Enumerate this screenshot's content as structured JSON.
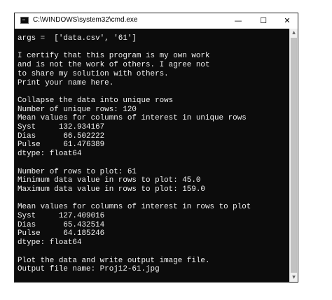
{
  "window": {
    "title": "C:\\WINDOWS\\system32\\cmd.exe",
    "app_icon": "console-icon",
    "controls": {
      "minimize": "—",
      "maximize": "☐",
      "close": "✕"
    }
  },
  "console": {
    "lines": [
      "args =  ['data.csv', '61']",
      "",
      "I certify that this program is my own work",
      "and is not the work of others. I agree not",
      "to share my solution with others.",
      "Print your name here.",
      "",
      "Collapse the data into unique rows",
      "Number of unique rows: 120",
      "Mean values for columns of interest in unique rows",
      "Syst     132.934167",
      "Dias      66.502222",
      "Pulse     61.476389",
      "dtype: float64",
      "",
      "Number of rows to plot: 61",
      "Minimum data value in rows to plot: 45.0",
      "Maximum data value in rows to plot: 159.0",
      "",
      "Mean values for columns of interest in rows to plot",
      "Syst     127.409016",
      "Dias      65.432514",
      "Pulse     64.185246",
      "dtype: float64",
      "",
      "Plot the data and write output image file.",
      "Output file name: Proj12-61.jpg"
    ]
  },
  "scrollbar": {
    "up_arrow": "▲",
    "down_arrow": "▼"
  },
  "colors": {
    "console_background": "#0c0c0c",
    "console_text": "#f2f2f2",
    "titlebar": "#ffffff",
    "scrollbar_track": "#f0f0f0",
    "scrollbar_thumb": "#c2c2c2"
  }
}
